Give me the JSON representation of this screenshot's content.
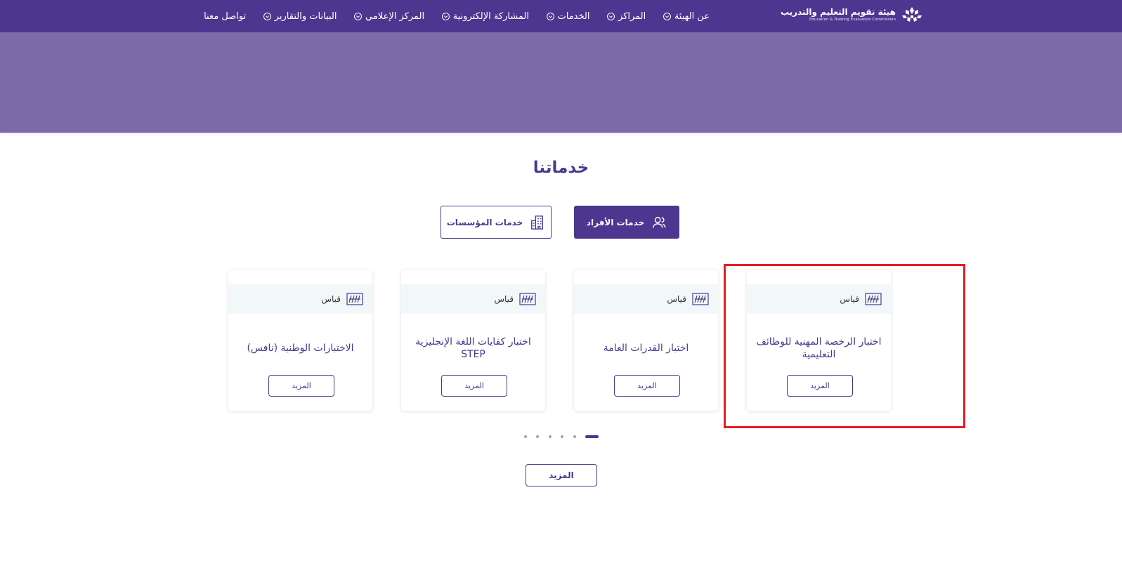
{
  "header": {
    "brand": {
      "name_ar": "هيئة تقويم التعليم والتدريب",
      "name_en": "Education & Training Evaluation Commission"
    },
    "nav": [
      {
        "label": "عن الهيئة",
        "has_dropdown": true
      },
      {
        "label": "المراكز",
        "has_dropdown": true
      },
      {
        "label": "الخدمات",
        "has_dropdown": true
      },
      {
        "label": "المشاركة الإلكترونية",
        "has_dropdown": true
      },
      {
        "label": "المركز الإعلامي",
        "has_dropdown": true
      },
      {
        "label": "البيانات والتقارير",
        "has_dropdown": true
      },
      {
        "label": "تواصل معنا",
        "has_dropdown": false
      }
    ]
  },
  "services": {
    "title": "خدماتنا",
    "tabs": [
      {
        "label": "خدمات الأفراد",
        "icon": "users-icon",
        "active": true
      },
      {
        "label": "خدمات المؤسسات",
        "icon": "building-icon",
        "active": false
      }
    ],
    "cards": [
      {
        "badge": "قياس",
        "title": "اختبار الرخصة المهنية للوظائف التعليمية",
        "button": "المزيد"
      },
      {
        "badge": "قياس",
        "title": "اختبار القدرات العامة",
        "button": "المزيد"
      },
      {
        "badge": "قياس",
        "title": "اختبار كفايات اللغة الإنجليزية STEP",
        "button": "المزيد"
      },
      {
        "badge": "قياس",
        "title": "الاختبارات الوطنية (نافس)",
        "button": "المزيد"
      }
    ],
    "pagination": {
      "total": 6,
      "active": 1
    },
    "more_label": "المزيد"
  },
  "colors": {
    "primary": "#4c3790",
    "hero": "#7d6aa9",
    "card_head": "#f2f8f9",
    "highlight": "#e31e24"
  }
}
